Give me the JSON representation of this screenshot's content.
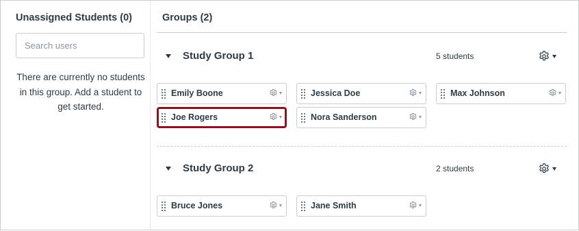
{
  "unassigned": {
    "title": "Unassigned Students (0)",
    "search_placeholder": "Search users",
    "empty_message": "There are currently no students in this group. Add a student to get started."
  },
  "groups_title": "Groups (2)",
  "groups": [
    {
      "name": "Study Group 1",
      "count": "5 students",
      "members": [
        "Emily Boone",
        "Jessica Doe",
        "Max Johnson",
        "Joe Rogers",
        "Nora Sanderson"
      ],
      "selected_member": "Joe Rogers"
    },
    {
      "name": "Study Group 2",
      "count": "2 students",
      "members": [
        "Bruce Jones",
        "Jane Smith"
      ]
    }
  ],
  "icons": {
    "group_toggle": "caret-down-icon",
    "settings": "gear-icon",
    "drag": "drag-handle-icon"
  },
  "colors": {
    "text": "#2d3b45",
    "border": "#c7cdd1",
    "highlight": "#8b1420"
  }
}
